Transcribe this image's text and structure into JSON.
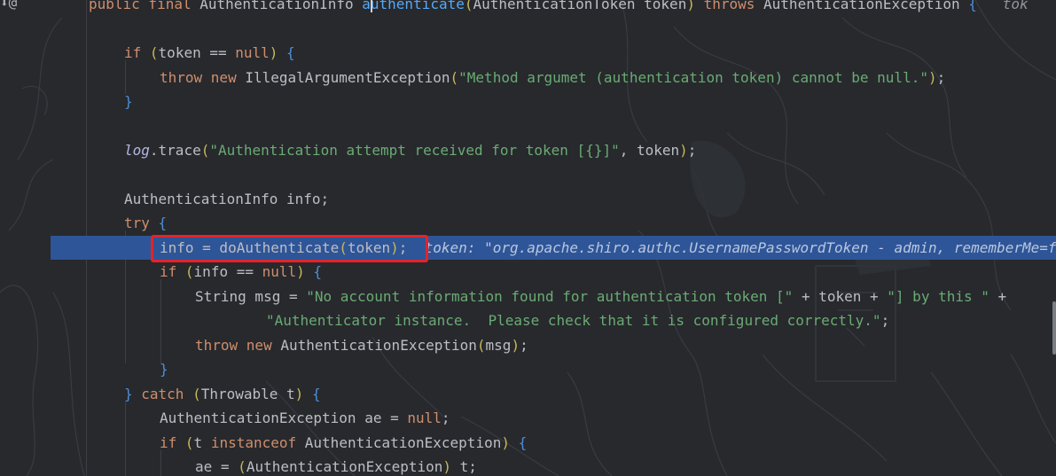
{
  "gutter": {
    "marker_text": "⬇@"
  },
  "lines": [
    {
      "name": "method-signature",
      "tokens": [
        {
          "t": "public final ",
          "c": "kw"
        },
        {
          "t": "AuthenticationInfo ",
          "c": "pl"
        },
        {
          "t": "authenticate",
          "c": "fn"
        },
        {
          "t": "(",
          "c": "paren"
        },
        {
          "t": "AuthenticationToken token",
          "c": "pl"
        },
        {
          "t": ") ",
          "c": "paren"
        },
        {
          "t": "throws ",
          "c": "kw"
        },
        {
          "t": "AuthenticationException ",
          "c": "pl"
        },
        {
          "t": "{",
          "c": "bracket"
        },
        {
          "t": "   tok",
          "c": "inline-hint"
        }
      ]
    },
    {
      "name": "if-token-null",
      "tokens": [
        {
          "t": "if ",
          "c": "kw"
        },
        {
          "t": "(",
          "c": "paren"
        },
        {
          "t": "token == ",
          "c": "pl"
        },
        {
          "t": "null",
          "c": "kw"
        },
        {
          "t": ") ",
          "c": "paren"
        },
        {
          "t": "{",
          "c": "bracket"
        }
      ]
    },
    {
      "name": "throw-illegal-argument",
      "tokens": [
        {
          "t": "throw new ",
          "c": "kw"
        },
        {
          "t": "IllegalArgumentException",
          "c": "pl"
        },
        {
          "t": "(",
          "c": "paren"
        },
        {
          "t": "\"Method argumet (authentication token) cannot be null.\"",
          "c": "st"
        },
        {
          "t": ")",
          "c": "paren"
        },
        {
          "t": ";",
          "c": "pl"
        }
      ]
    },
    {
      "name": "close-if-token",
      "tokens": [
        {
          "t": "}",
          "c": "bracket"
        }
      ]
    },
    {
      "name": "log-trace",
      "tokens": [
        {
          "t": "log",
          "c": "lg"
        },
        {
          "t": ".trace",
          "c": "pl"
        },
        {
          "t": "(",
          "c": "paren"
        },
        {
          "t": "\"Authentication attempt received for token [{}]\"",
          "c": "st"
        },
        {
          "t": ", token",
          "c": "pl"
        },
        {
          "t": ")",
          "c": "paren"
        },
        {
          "t": ";",
          "c": "pl"
        }
      ]
    },
    {
      "name": "declare-info",
      "tokens": [
        {
          "t": "AuthenticationInfo info;",
          "c": "pl"
        }
      ]
    },
    {
      "name": "try-open",
      "tokens": [
        {
          "t": "try ",
          "c": "kw"
        },
        {
          "t": "{",
          "c": "bracket"
        }
      ]
    },
    {
      "name": "do-authenticate",
      "tokens": [
        {
          "t": "info = doAuthenticate",
          "c": "pl"
        },
        {
          "t": "(",
          "c": "paren"
        },
        {
          "t": "token",
          "c": "pl"
        },
        {
          "t": ")",
          "c": "paren"
        },
        {
          "t": ";",
          "c": "pl"
        }
      ],
      "hint": "token: \"org.apache.shiro.authc.UsernamePasswordToken - admin, rememberMe=false\""
    },
    {
      "name": "if-info-null",
      "tokens": [
        {
          "t": "if ",
          "c": "kw"
        },
        {
          "t": "(",
          "c": "paren"
        },
        {
          "t": "info == ",
          "c": "pl"
        },
        {
          "t": "null",
          "c": "kw"
        },
        {
          "t": ") ",
          "c": "paren"
        },
        {
          "t": "{",
          "c": "bracket"
        }
      ]
    },
    {
      "name": "string-msg",
      "tokens": [
        {
          "t": "String msg = ",
          "c": "pl"
        },
        {
          "t": "\"No account information found for authentication token [\"",
          "c": "st"
        },
        {
          "t": " + token + ",
          "c": "pl"
        },
        {
          "t": "\"] by this \"",
          "c": "st"
        },
        {
          "t": " + ",
          "c": "pl"
        }
      ]
    },
    {
      "name": "string-msg-cont",
      "tokens": [
        {
          "t": "\"Authenticator instance.  Please check that it is configured correctly.\"",
          "c": "st"
        },
        {
          "t": ";",
          "c": "pl"
        }
      ]
    },
    {
      "name": "throw-auth-exception",
      "tokens": [
        {
          "t": "throw new ",
          "c": "kw"
        },
        {
          "t": "AuthenticationException",
          "c": "pl"
        },
        {
          "t": "(",
          "c": "paren"
        },
        {
          "t": "msg",
          "c": "pl"
        },
        {
          "t": ")",
          "c": "paren"
        },
        {
          "t": ";",
          "c": "pl"
        }
      ]
    },
    {
      "name": "close-if-info",
      "tokens": [
        {
          "t": "}",
          "c": "bracket"
        }
      ]
    },
    {
      "name": "catch-throwable",
      "tokens": [
        {
          "t": "} ",
          "c": "bracket"
        },
        {
          "t": "catch ",
          "c": "kw"
        },
        {
          "t": "(",
          "c": "paren"
        },
        {
          "t": "Throwable t",
          "c": "pl"
        },
        {
          "t": ") ",
          "c": "paren"
        },
        {
          "t": "{",
          "c": "bracket"
        }
      ]
    },
    {
      "name": "declare-ae",
      "tokens": [
        {
          "t": "AuthenticationException ae = ",
          "c": "pl"
        },
        {
          "t": "null",
          "c": "kw"
        },
        {
          "t": ";",
          "c": "pl"
        }
      ]
    },
    {
      "name": "if-instanceof",
      "tokens": [
        {
          "t": "if ",
          "c": "kw"
        },
        {
          "t": "(",
          "c": "paren"
        },
        {
          "t": "t ",
          "c": "pl"
        },
        {
          "t": "instanceof ",
          "c": "kw"
        },
        {
          "t": "AuthenticationException",
          "c": "pl"
        },
        {
          "t": ") ",
          "c": "paren"
        },
        {
          "t": "{",
          "c": "bracket"
        }
      ]
    },
    {
      "name": "ae-cast",
      "tokens": [
        {
          "t": "ae = ",
          "c": "pl"
        },
        {
          "t": "(",
          "c": "paren"
        },
        {
          "t": "AuthenticationException",
          "c": "pl"
        },
        {
          "t": ") ",
          "c": "paren"
        },
        {
          "t": "t;",
          "c": "pl"
        }
      ]
    }
  ]
}
